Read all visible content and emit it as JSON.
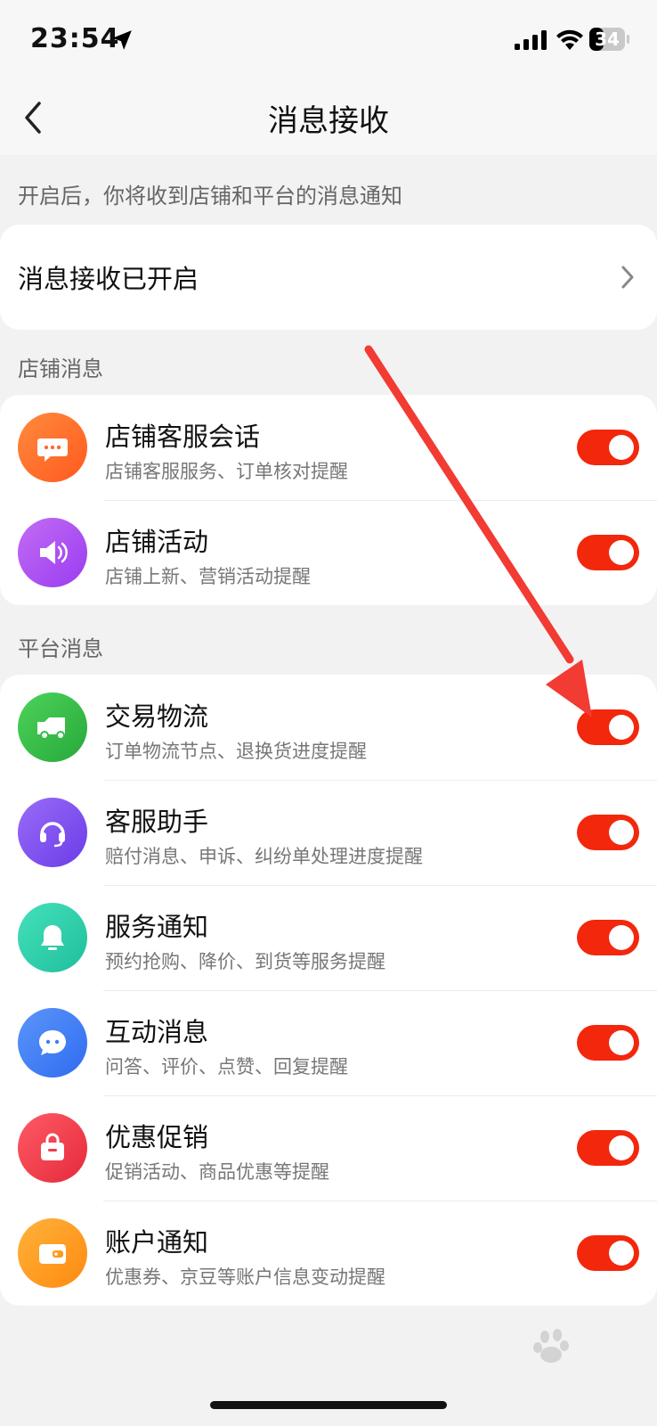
{
  "status_bar": {
    "time": "23:54",
    "battery": "34"
  },
  "nav": {
    "title": "消息接收"
  },
  "hint": "开启后，你将收到店铺和平台的消息通知",
  "receive_status": {
    "label": "消息接收已开启"
  },
  "sections": {
    "shop": {
      "title": "店铺消息",
      "items": [
        {
          "title": "店铺客服会话",
          "subtitle": "店铺客服服务、订单核对提醒",
          "enabled": true,
          "icon": "chat-bubble-icon",
          "color": "#ff6a2b"
        },
        {
          "title": "店铺活动",
          "subtitle": "店铺上新、营销活动提醒",
          "enabled": true,
          "icon": "speaker-icon",
          "color": "#b24cf0"
        }
      ]
    },
    "platform": {
      "title": "平台消息",
      "items": [
        {
          "title": "交易物流",
          "subtitle": "订单物流节点、退换货进度提醒",
          "enabled": true,
          "icon": "truck-icon",
          "color": "#34bd45"
        },
        {
          "title": "客服助手",
          "subtitle": "赔付消息、申诉、纠纷单处理进度提醒",
          "enabled": true,
          "icon": "headset-icon",
          "color": "#7d4cf2"
        },
        {
          "title": "服务通知",
          "subtitle": "预约抢购、降价、到货等服务提醒",
          "enabled": true,
          "icon": "bell-icon",
          "color": "#2ed1ad"
        },
        {
          "title": "互动消息",
          "subtitle": "问答、评价、点赞、回复提醒",
          "enabled": true,
          "icon": "message-bubble-icon",
          "color": "#3d7cf5"
        },
        {
          "title": "优惠促销",
          "subtitle": "促销活动、商品优惠等提醒",
          "enabled": true,
          "icon": "gift-bag-icon",
          "color": "#f23a4a"
        },
        {
          "title": "账户通知",
          "subtitle": "优惠券、京豆等账户信息变动提醒",
          "enabled": true,
          "icon": "wallet-icon",
          "color": "#ff9a1c"
        }
      ]
    }
  },
  "colors": {
    "toggle_on": "#f2270c",
    "annotation_arrow": "#f23b32"
  }
}
